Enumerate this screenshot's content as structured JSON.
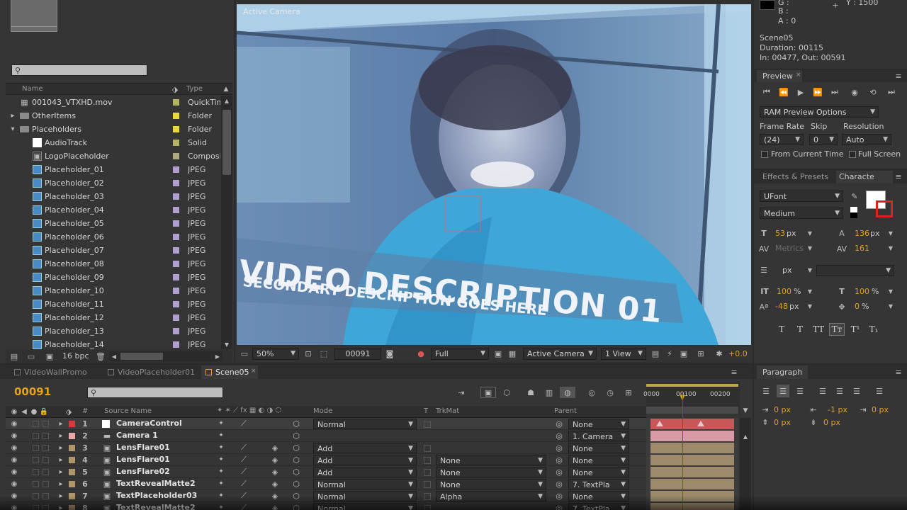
{
  "project": {
    "search_placeholder": "",
    "columns": {
      "name": "Name",
      "type": "Type"
    },
    "items": [
      {
        "name": "001043_VTXHD.mov",
        "type": "QuickTim",
        "color": "#b4b464",
        "indent": 0,
        "tw": "",
        "ic": "mov"
      },
      {
        "name": "OtherItems",
        "type": "Folder",
        "color": "#e8d83a",
        "indent": 0,
        "tw": "▸",
        "ic": "folder"
      },
      {
        "name": "Placeholders",
        "type": "Folder",
        "color": "#e8d83a",
        "indent": 0,
        "tw": "▾",
        "ic": "folder"
      },
      {
        "name": "AudioTrack",
        "type": "Solid",
        "color": "#b4b464",
        "indent": 1,
        "tw": "",
        "ic": "solid"
      },
      {
        "name": "LogoPlaceholder",
        "type": "Composi",
        "color": "#b0a882",
        "indent": 1,
        "tw": "",
        "ic": "comp"
      },
      {
        "name": "Placeholder_01",
        "type": "JPEG",
        "color": "#b0a0d0",
        "indent": 1,
        "tw": "",
        "ic": "img"
      },
      {
        "name": "Placeholder_02",
        "type": "JPEG",
        "color": "#b0a0d0",
        "indent": 1,
        "tw": "",
        "ic": "img"
      },
      {
        "name": "Placeholder_03",
        "type": "JPEG",
        "color": "#b0a0d0",
        "indent": 1,
        "tw": "",
        "ic": "img"
      },
      {
        "name": "Placeholder_04",
        "type": "JPEG",
        "color": "#b0a0d0",
        "indent": 1,
        "tw": "",
        "ic": "img"
      },
      {
        "name": "Placeholder_05",
        "type": "JPEG",
        "color": "#b0a0d0",
        "indent": 1,
        "tw": "",
        "ic": "img"
      },
      {
        "name": "Placeholder_06",
        "type": "JPEG",
        "color": "#b0a0d0",
        "indent": 1,
        "tw": "",
        "ic": "img"
      },
      {
        "name": "Placeholder_07",
        "type": "JPEG",
        "color": "#b0a0d0",
        "indent": 1,
        "tw": "",
        "ic": "img"
      },
      {
        "name": "Placeholder_08",
        "type": "JPEG",
        "color": "#b0a0d0",
        "indent": 1,
        "tw": "",
        "ic": "img"
      },
      {
        "name": "Placeholder_09",
        "type": "JPEG",
        "color": "#b0a0d0",
        "indent": 1,
        "tw": "",
        "ic": "img"
      },
      {
        "name": "Placeholder_10",
        "type": "JPEG",
        "color": "#b0a0d0",
        "indent": 1,
        "tw": "",
        "ic": "img"
      },
      {
        "name": "Placeholder_11",
        "type": "JPEG",
        "color": "#b0a0d0",
        "indent": 1,
        "tw": "",
        "ic": "img"
      },
      {
        "name": "Placeholder_12",
        "type": "JPEG",
        "color": "#b0a0d0",
        "indent": 1,
        "tw": "",
        "ic": "img"
      },
      {
        "name": "Placeholder_13",
        "type": "JPEG",
        "color": "#b0a0d0",
        "indent": 1,
        "tw": "",
        "ic": "img"
      },
      {
        "name": "Placeholder_14",
        "type": "JPEG",
        "color": "#b0a0d0",
        "indent": 1,
        "tw": "",
        "ic": "img"
      }
    ],
    "bpc": "16 bpc"
  },
  "viewer": {
    "label": "Active Camera",
    "headline": "VIDEO DESCRIPTION 01",
    "subline": "SECONDARY DESCRIPTION GOES HERE",
    "zoom": "50%",
    "frame": "00091",
    "resolution": "Full",
    "camera": "Active Camera",
    "views": "1 View",
    "exposure": "+0.0"
  },
  "info": {
    "g": "G :",
    "b": "B :",
    "a": "A : 0",
    "y": "Y : 1500",
    "comp_name": "Scene05",
    "duration": "Duration: 00115",
    "inout": "In: 00477, Out: 00591"
  },
  "preview": {
    "tab": "Preview",
    "ram_options": "RAM Preview Options",
    "frame_rate_label": "Frame Rate",
    "skip_label": "Skip",
    "resolution_label": "Resolution",
    "frame_rate": "(24)",
    "skip": "0",
    "resolution": "Auto",
    "from_current": "From Current Time",
    "full_screen": "Full Screen"
  },
  "character": {
    "tab_effects": "Effects & Presets",
    "tab_character": "Characte",
    "font": "UFont",
    "style": "Medium",
    "size": "53",
    "size_unit": "px",
    "leading": "136",
    "leading_unit": "px",
    "kerning": "Metrics",
    "tracking": "161",
    "stroke_unit": "px",
    "vscale": "100",
    "vscale_unit": "%",
    "hscale": "100",
    "hscale_unit": "%",
    "baseline": "-48",
    "baseline_unit": "px",
    "tsume": "0",
    "tsume_unit": "%",
    "styles": [
      "T",
      "T",
      "TT",
      "Tт",
      "T¹",
      "T₁"
    ]
  },
  "paragraph": {
    "tab": "Paragraph",
    "indent_left": "0 px",
    "indent_right": "-1 px",
    "first_line": "0 px",
    "space_before": "0 px",
    "space_after": "0 px"
  },
  "timeline": {
    "tabs": [
      "VideoWallPromo",
      "VideoPlaceholder01",
      "Scene05"
    ],
    "timecode": "00091",
    "ruler": [
      "0000",
      "00100",
      "00200"
    ],
    "headers": {
      "num": "#",
      "source": "Source Name",
      "mode": "Mode",
      "t": "T",
      "trkmat": "TrkMat",
      "parent": "Parent"
    },
    "layers": [
      {
        "num": "1",
        "name": "CameraControl",
        "label": "#d23c3c",
        "mode": "Normal",
        "trk": "",
        "parent": "None",
        "sel": true,
        "type": "null"
      },
      {
        "num": "2",
        "name": "Camera 1",
        "label": "#e8a8a8",
        "mode": "",
        "trk": "",
        "parent": "1. Camera",
        "sel": false,
        "type": "cam"
      },
      {
        "num": "3",
        "name": "LensFlare01",
        "label": "#b0966a",
        "mode": "Add",
        "trk": "",
        "parent": "None",
        "sel": false,
        "type": "comp"
      },
      {
        "num": "4",
        "name": "LensFlare01",
        "label": "#b0966a",
        "mode": "Add",
        "trk": "None",
        "parent": "None",
        "sel": false,
        "type": "comp"
      },
      {
        "num": "5",
        "name": "LensFlare02",
        "label": "#b0966a",
        "mode": "Add",
        "trk": "None",
        "parent": "None",
        "sel": false,
        "type": "comp"
      },
      {
        "num": "6",
        "name": "TextRevealMatte2",
        "label": "#b0966a",
        "mode": "Normal",
        "trk": "None",
        "parent": "7. TextPla",
        "sel": false,
        "type": "comp"
      },
      {
        "num": "7",
        "name": "TextPlaceholder03",
        "label": "#b0966a",
        "mode": "Normal",
        "trk": "Alpha",
        "parent": "None",
        "sel": false,
        "type": "comp"
      },
      {
        "num": "8",
        "name": "TextRevealMatte2",
        "label": "#b0966a",
        "mode": "Normal",
        "trk": "",
        "parent": "7. TextPla",
        "sel": false,
        "type": "comp"
      }
    ]
  }
}
